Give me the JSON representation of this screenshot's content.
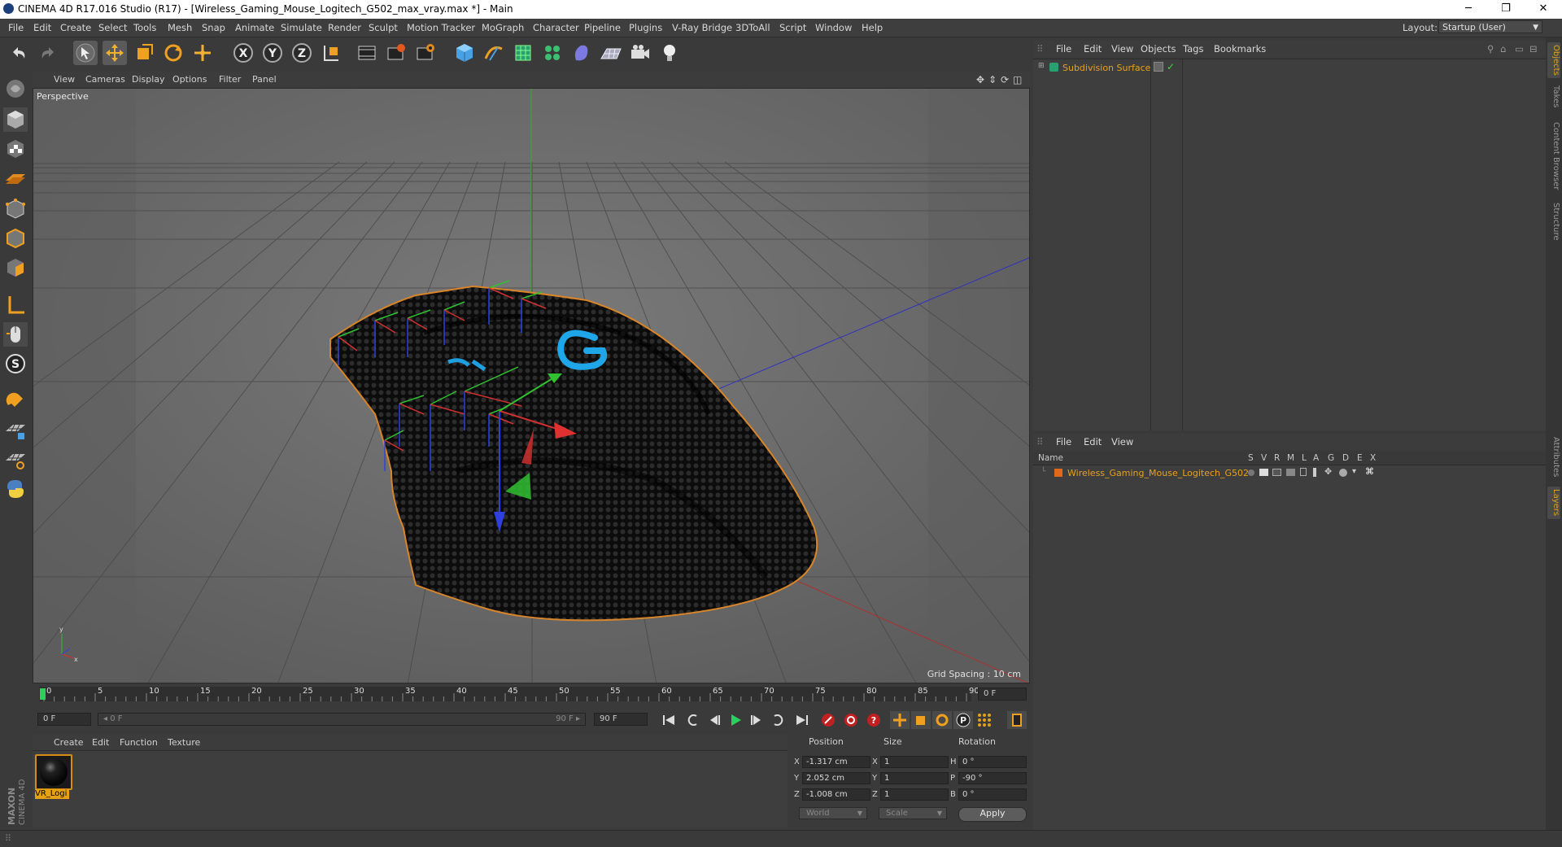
{
  "window": {
    "title": "CINEMA 4D R17.016 Studio (R17) - [Wireless_Gaming_Mouse_Logitech_G502_max_vray.max *] - Main",
    "minimize": "─",
    "restore": "❐",
    "close": "✕"
  },
  "menubar": {
    "items": [
      "File",
      "Edit",
      "Create",
      "Select",
      "Tools",
      "Mesh",
      "Snap",
      "Animate",
      "Simulate",
      "Render",
      "Sculpt",
      "Motion Tracker",
      "MoGraph",
      "Character",
      "Pipeline",
      "Plugins",
      "V-Ray Bridge",
      "3DToAll",
      "Script",
      "Window",
      "Help"
    ],
    "layout_label": "Layout:",
    "layout_value": "Startup (User)"
  },
  "viewport": {
    "menu": [
      "View",
      "Cameras",
      "Display",
      "Options",
      "Filter",
      "Panel"
    ],
    "label": "Perspective",
    "grid_spacing": "Grid Spacing : 10 cm"
  },
  "timeline": {
    "ticks": [
      "0",
      "5",
      "10",
      "15",
      "20",
      "25",
      "30",
      "35",
      "40",
      "45",
      "50",
      "55",
      "60",
      "65",
      "70",
      "75",
      "80",
      "85",
      "90"
    ],
    "frame_display": "0 F",
    "start_field": "0 F",
    "range_start": "◂ 0 F",
    "range_end": "90 F ▸",
    "end_field": "90 F"
  },
  "materials": {
    "menu": [
      "Create",
      "Edit",
      "Function",
      "Texture"
    ],
    "items": [
      {
        "name": "VR_Logi"
      }
    ]
  },
  "coordinates": {
    "headers": {
      "position": "Position",
      "size": "Size",
      "rotation": "Rotation"
    },
    "rows": [
      {
        "axis": "X",
        "position": "-1.317 cm",
        "size_axis": "X",
        "size": "1",
        "rot_axis": "H",
        "rotation": "0 °"
      },
      {
        "axis": "Y",
        "position": "2.052 cm",
        "size_axis": "Y",
        "size": "1",
        "rot_axis": "P",
        "rotation": "-90 °"
      },
      {
        "axis": "Z",
        "position": "-1.008 cm",
        "size_axis": "Z",
        "size": "1",
        "rot_axis": "B",
        "rotation": "0 °"
      }
    ],
    "mode": "World",
    "scale_mode": "Scale",
    "apply": "Apply"
  },
  "objects": {
    "menu": [
      "File",
      "Edit",
      "View",
      "Objects",
      "Tags",
      "Bookmarks"
    ],
    "items": [
      {
        "name": "Subdivision Surface"
      }
    ]
  },
  "layers": {
    "menu": [
      "File",
      "Edit",
      "View"
    ],
    "columns": [
      "Name",
      "S",
      "V",
      "R",
      "M",
      "L",
      "A",
      "G",
      "D",
      "E",
      "X"
    ],
    "items": [
      {
        "name": "Wireless_Gaming_Mouse_Logitech_G502"
      }
    ]
  },
  "right_tabs": [
    "Objects",
    "Takes",
    "Content Browser",
    "Structure",
    "Attributes",
    "Layers"
  ],
  "branding": {
    "logo_text": "MAXON CINEMA 4D"
  },
  "colors": {
    "accent_orange": "#e6a21a",
    "viewport_bg": "#6a6a6a",
    "panel_bg": "#3e3e3e",
    "axis_x": "#d03030",
    "axis_y": "#30c030",
    "axis_z": "#3040d0"
  }
}
